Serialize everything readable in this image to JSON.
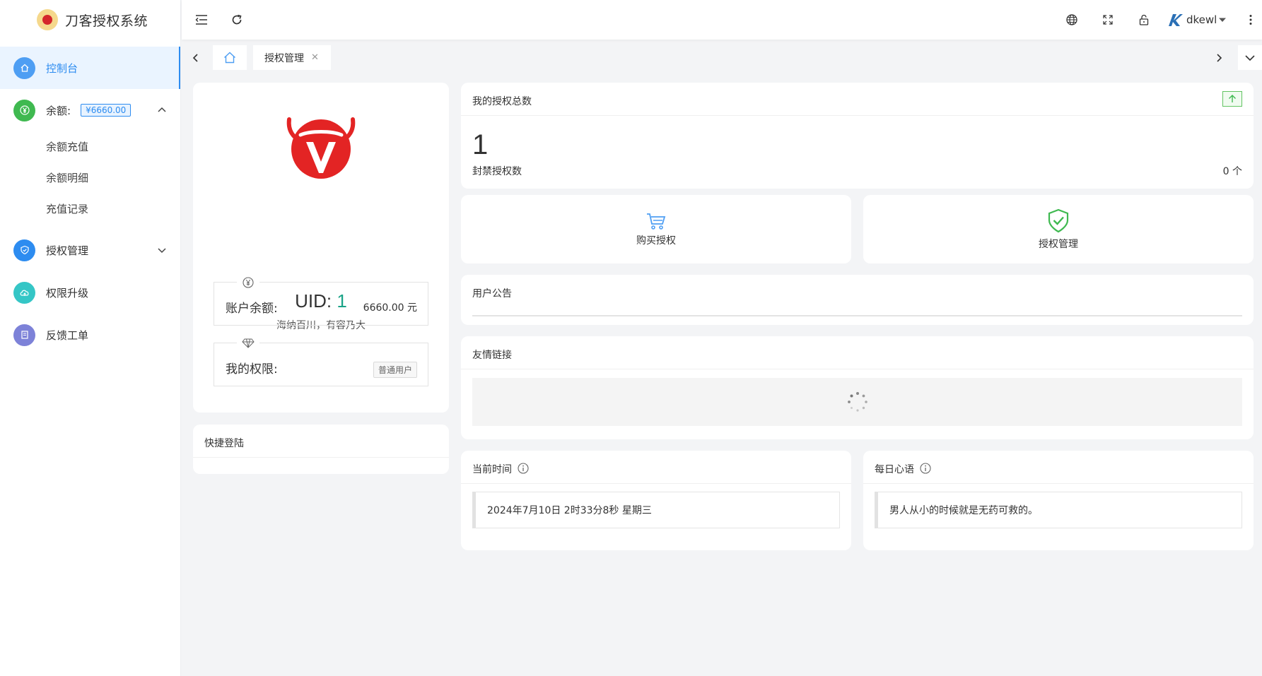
{
  "app": {
    "title": "刀客授权系统"
  },
  "sidebar": {
    "items": [
      {
        "label": "控制台",
        "icon": "home-icon",
        "color": "#4e9ef3",
        "active": true
      },
      {
        "label": "余额:",
        "icon": "yen-icon",
        "color": "#3fb950",
        "badge": "¥6660.00",
        "expanded": true,
        "children": [
          "余额充值",
          "余额明细",
          "充值记录"
        ]
      },
      {
        "label": "授权管理",
        "icon": "shield-icon",
        "color": "#2d8cf0"
      },
      {
        "label": "权限升级",
        "icon": "cloud-upload-icon",
        "color": "#35c6c6"
      },
      {
        "label": "反馈工单",
        "icon": "ticket-icon",
        "color": "#7d82d8"
      }
    ]
  },
  "header": {
    "icons": [
      "menu-fold-icon",
      "refresh-icon",
      "language-icon",
      "fullscreen-icon",
      "lock-icon",
      "more-icon"
    ],
    "user": {
      "name": "dkewl"
    }
  },
  "tabs": {
    "items": [
      {
        "label": "授权管理"
      }
    ]
  },
  "profile": {
    "uid_label": "UID: ",
    "uid_value": "1",
    "motto": "海纳百川，有容乃大",
    "balance_label": "账户余额:",
    "balance_value": "6660.00 元",
    "permission_label": "我的权限:",
    "permission_value": "普通用户"
  },
  "quick_login": {
    "title": "快捷登陆"
  },
  "auth_total": {
    "title": "我的授权总数",
    "count": "1",
    "banned_label": "封禁授权数",
    "banned_value": "0 个"
  },
  "actions": [
    {
      "label": "购买授权",
      "icon": "cart-icon",
      "color": "#4e9ef3"
    },
    {
      "label": "授权管理",
      "icon": "shield-check-icon",
      "color": "#3fb950"
    }
  ],
  "notice": {
    "title": "用户公告"
  },
  "links": {
    "title": "友情链接"
  },
  "time": {
    "title": "当前时间",
    "value": "2024年7月10日 2时33分8秒 星期三"
  },
  "daily": {
    "title": "每日心语",
    "value": "男人从小的时候就是无药可救的。"
  }
}
